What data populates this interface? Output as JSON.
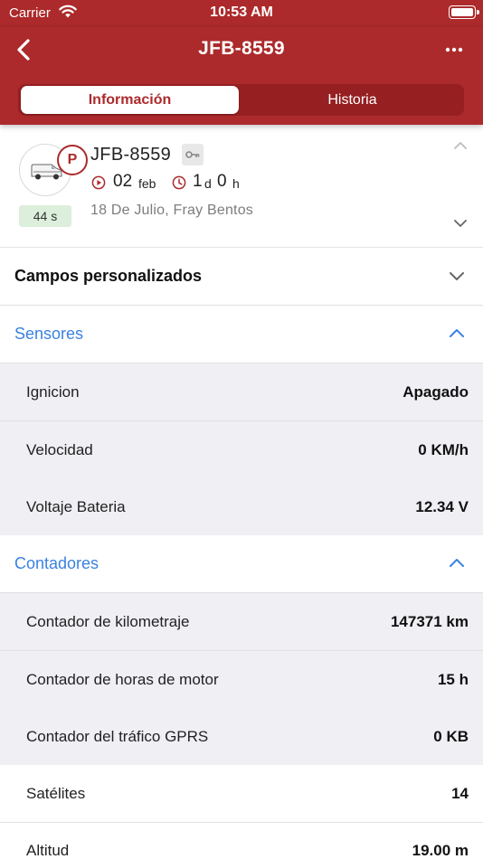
{
  "status_bar": {
    "carrier": "Carrier",
    "time": "10:53 AM",
    "icons": [
      "wifi-icon",
      "battery-icon"
    ]
  },
  "header": {
    "title": "JFB-8559",
    "back_icon": "chevron-left-icon",
    "more_icon": "more-icon"
  },
  "tabs": [
    {
      "label": "Información",
      "selected": true
    },
    {
      "label": "Historia",
      "selected": false
    }
  ],
  "vehicle": {
    "name": "JFB-8559",
    "status_badge": "P",
    "age": "44 s",
    "date_day": "02",
    "date_month": "feb",
    "duration_days": "1",
    "duration_days_unit": "d",
    "duration_hours": "0",
    "duration_hours_unit": "h",
    "address": "18 De Julio, Fray Bentos"
  },
  "sections": {
    "custom_fields": {
      "label": "Campos personalizados",
      "expanded": false
    },
    "sensors": {
      "label": "Sensores",
      "expanded": true,
      "items": [
        {
          "label": "Ignicion",
          "value": "Apagado"
        },
        {
          "label": "Velocidad",
          "value": "0 KM/h"
        },
        {
          "label": "Voltaje Bateria",
          "value": "12.34 V"
        }
      ]
    },
    "counters": {
      "label": "Contadores",
      "expanded": true,
      "items": [
        {
          "label": "Contador de kilometraje",
          "value": "147371 km"
        },
        {
          "label": "Contador de horas de motor",
          "value": "15 h"
        },
        {
          "label": "Contador del tráfico GPRS",
          "value": "0 KB"
        }
      ]
    },
    "other": [
      {
        "label": "Satélites",
        "value": "14"
      },
      {
        "label": "Altitud",
        "value": "19.00 m"
      }
    ]
  },
  "colors": {
    "brand_red": "#ac2a2b",
    "segment_track": "#951f21",
    "section_blue": "#3a82e0",
    "sub_row_bg": "#efeff4",
    "age_badge_bg": "#dcefdc"
  }
}
